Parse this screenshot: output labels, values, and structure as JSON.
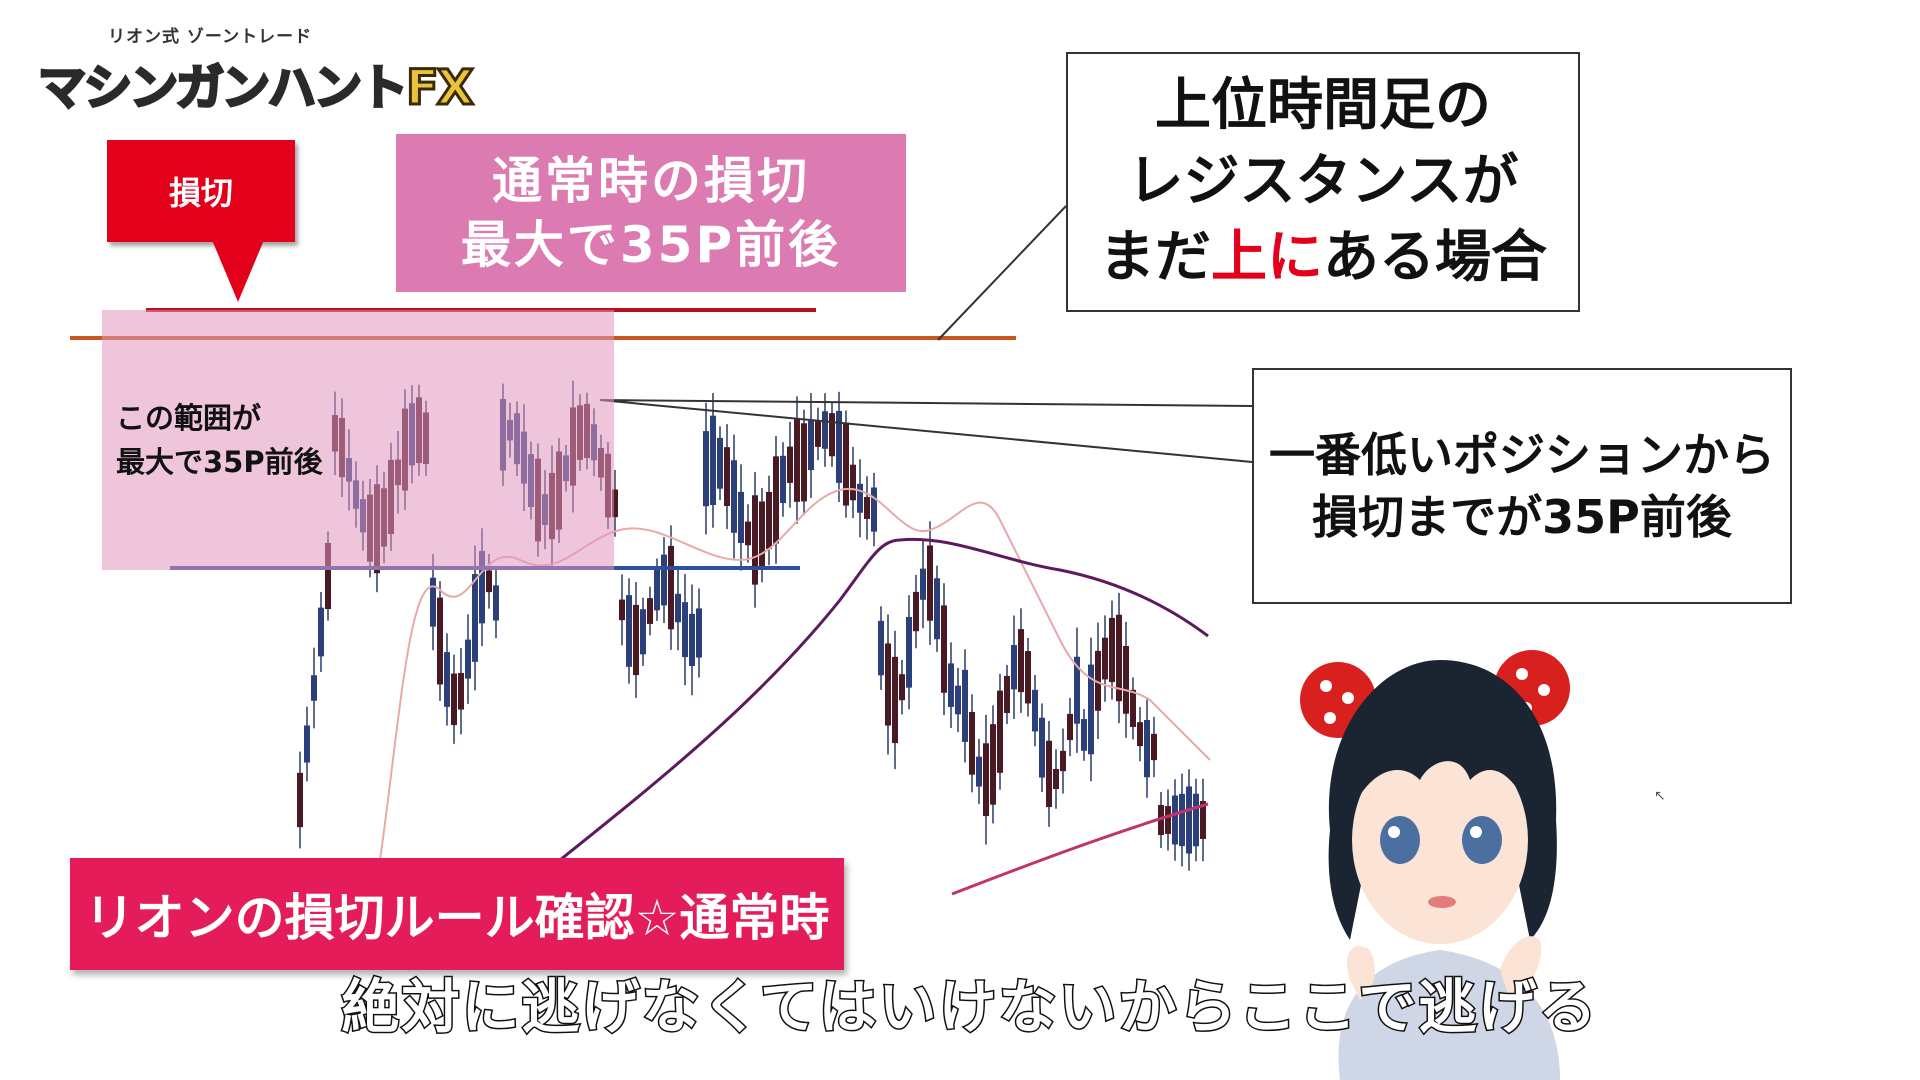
{
  "logo": {
    "subtitle": "リオン式 ゾーントレード",
    "title": "マシンガンハント",
    "fx": "FX"
  },
  "stop_loss_tag": "損切",
  "pink_box": {
    "line1": "通常時の損切",
    "line2": "最大で35P前後"
  },
  "range_label": {
    "line1": "この範囲が",
    "line2": "最大で35P前後"
  },
  "callout_upper": {
    "line1": "上位時間足の",
    "line2": "レジスタンスが",
    "line3_pre": "まだ",
    "line3_red": "上に",
    "line3_post": "ある場合"
  },
  "callout_lowest": {
    "line1": "一番低いポジションから",
    "line2": "損切までが35P前後"
  },
  "banner": "リオンの損切ルール確認☆通常時",
  "subtitle": "絶対に逃げなくてはいけないからここで逃げる",
  "colors": {
    "stop_loss_red": "#e3001b",
    "pink_box": "#db7bb1",
    "resistance_line": "#c7561f",
    "stop_line": "#b8101e",
    "support_line": "#2f4f9e",
    "banner": "#e41c5a"
  }
}
